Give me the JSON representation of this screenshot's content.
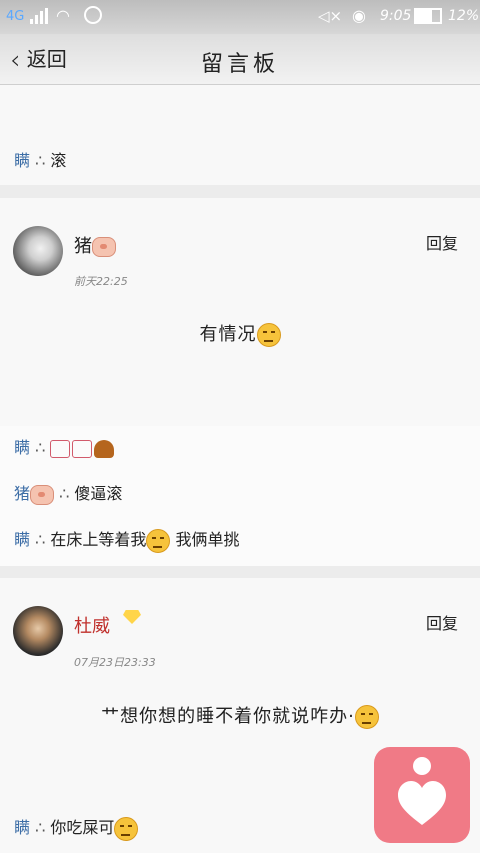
{
  "status": {
    "network": "4G",
    "time": "9:05",
    "battery": "12%"
  },
  "nav": {
    "back_label": "返回",
    "title": "留言板"
  },
  "card1": {
    "comment": {
      "user": "瞒",
      "sep": "∴",
      "text": "滚"
    }
  },
  "card2": {
    "author": "猪",
    "time": "前天22:25",
    "reply_label": "回复",
    "message": "有情况",
    "comments": [
      {
        "user": "瞒",
        "sep": "∴"
      },
      {
        "user": "猪",
        "sep": "∴",
        "text": "傻逼滚"
      },
      {
        "user": "瞒",
        "sep": "∴",
        "text1": "在床上等着我",
        "text2": "我俩单挑"
      }
    ]
  },
  "card3": {
    "author": "杜威",
    "time": "07月23日23:33",
    "reply_label": "回复",
    "message": "艹想你想的睡不着你就说咋办·",
    "comment": {
      "user": "瞒",
      "sep": "∴",
      "text": "你吃屎可"
    }
  },
  "colors": {
    "accent_fab": "#f07a86",
    "author_red": "#c0302c",
    "username_blue": "#3c6da6"
  }
}
